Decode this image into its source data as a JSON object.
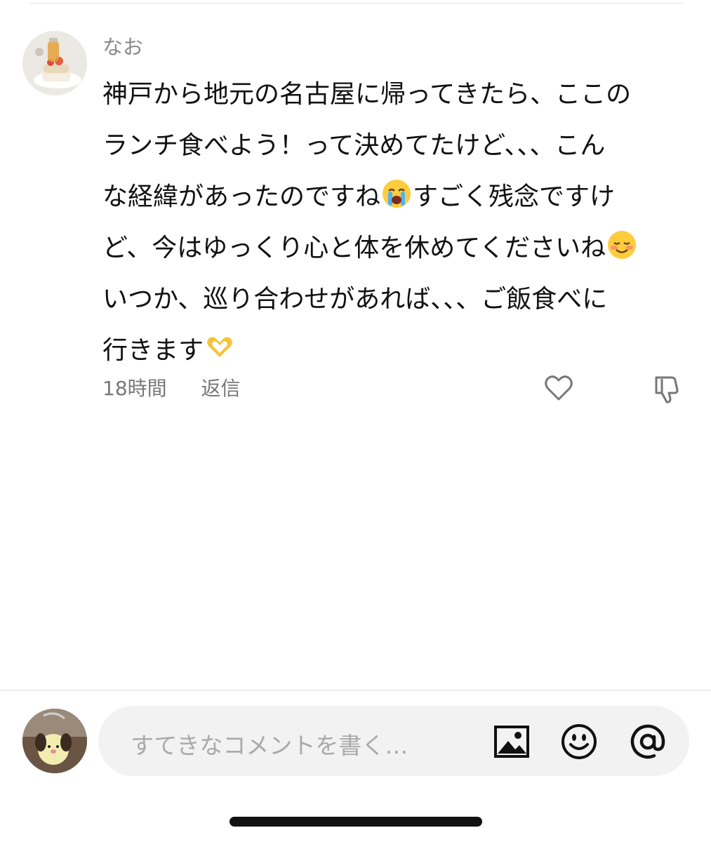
{
  "comment": {
    "username": "なお",
    "lines": [
      "神戸から地元の名古屋に帰ってきたら、ここの",
      "ランチ食べよう！って決めてたけど、、、こん",
      "な経緯があったのですね",
      "すごく残念ですけ",
      "ど、今はゆっくり心と体を休めてくださいね",
      "いつか、巡り合わせがあれば、、、ご飯食べに",
      "行きます"
    ],
    "emojis": [
      "crying-face",
      "smiling-face-blushing",
      "heart-hands"
    ],
    "time": "18時間",
    "reply_label": "返信"
  },
  "composer": {
    "placeholder": "すてきなコメントを書く…",
    "icons": [
      "image-icon",
      "emoji-icon",
      "mention-icon"
    ]
  },
  "colors": {
    "text": "#111111",
    "muted": "#777777",
    "input_bg": "#f2f2f2",
    "placeholder": "#a9a9a9"
  }
}
